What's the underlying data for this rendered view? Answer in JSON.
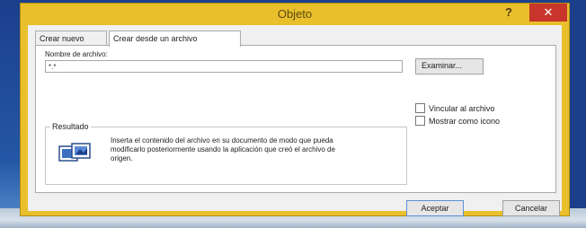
{
  "dialog": {
    "title": "Objeto",
    "help_label": "?",
    "close_label": "✕"
  },
  "tabs": [
    {
      "label": "Crear nuevo"
    },
    {
      "label": "Crear desde un archivo"
    }
  ],
  "file": {
    "label": "Nombre de archivo:",
    "value": "*.*",
    "browse_label": "Examinar..."
  },
  "options": {
    "link_label": "Vincular al archivo",
    "icon_label": "Mostrar como icono"
  },
  "result": {
    "legend": "Resultado",
    "text": "Inserta el contenido del archivo en su documento de modo que pueda modificarlo posteriormente usando la aplicación que creó el archivo de origen."
  },
  "buttons": {
    "ok": "Aceptar",
    "cancel": "Cancelar"
  },
  "colors": {
    "frame": "#e9bf2b",
    "close": "#c8352a",
    "desktop": "#1c3f8c"
  }
}
